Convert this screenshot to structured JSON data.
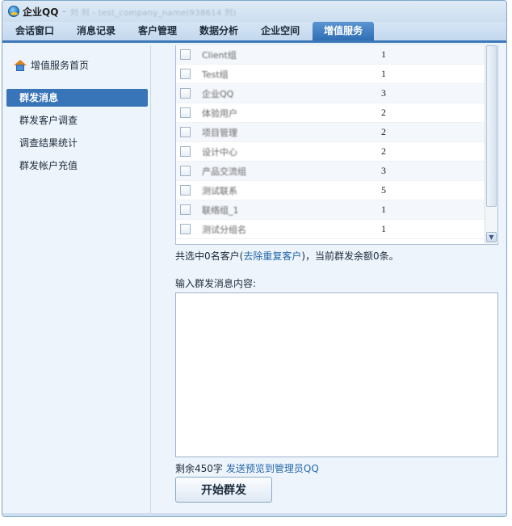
{
  "titlebar": {
    "app_name": "企业QQ",
    "separator": "-",
    "account": "刘 刘 - test_company_name(938614 刘)"
  },
  "tabs": [
    {
      "label": "会话窗口",
      "active": false
    },
    {
      "label": "消息记录",
      "active": false
    },
    {
      "label": "客户管理",
      "active": false
    },
    {
      "label": "数据分析",
      "active": false
    },
    {
      "label": "企业空间",
      "active": false
    },
    {
      "label": "增值服务",
      "active": true
    }
  ],
  "sidebar": {
    "home_label": "增值服务首页",
    "home_icon": "home-icon",
    "items": [
      {
        "label": "群发消息",
        "active": true
      },
      {
        "label": "群发客户调查",
        "active": false
      },
      {
        "label": "调查结果统计",
        "active": false
      },
      {
        "label": "群发帐户充值",
        "active": false
      }
    ]
  },
  "group_list": {
    "rows": [
      {
        "name": "Client组",
        "count": "1"
      },
      {
        "name": "Test组",
        "count": "1"
      },
      {
        "name": "企业QQ",
        "count": "3"
      },
      {
        "name": "体验用户",
        "count": "2"
      },
      {
        "name": "项目管理",
        "count": "2"
      },
      {
        "name": "设计中心",
        "count": "2"
      },
      {
        "name": "产品交流组",
        "count": "3"
      },
      {
        "name": "测试联系",
        "count": "5"
      },
      {
        "name": "联络组_1",
        "count": "1"
      },
      {
        "name": "测试分组名",
        "count": "1"
      }
    ]
  },
  "summary": {
    "prefix": "共选中0名客户(",
    "link": "去除重复客户",
    "suffix": ")，当前群发余额0条。"
  },
  "message": {
    "label": "输入群发消息内容:",
    "value": "",
    "remaining": "剩余450字",
    "preview_link": "发送预览到管理员QQ"
  },
  "start_button": "开始群发"
}
